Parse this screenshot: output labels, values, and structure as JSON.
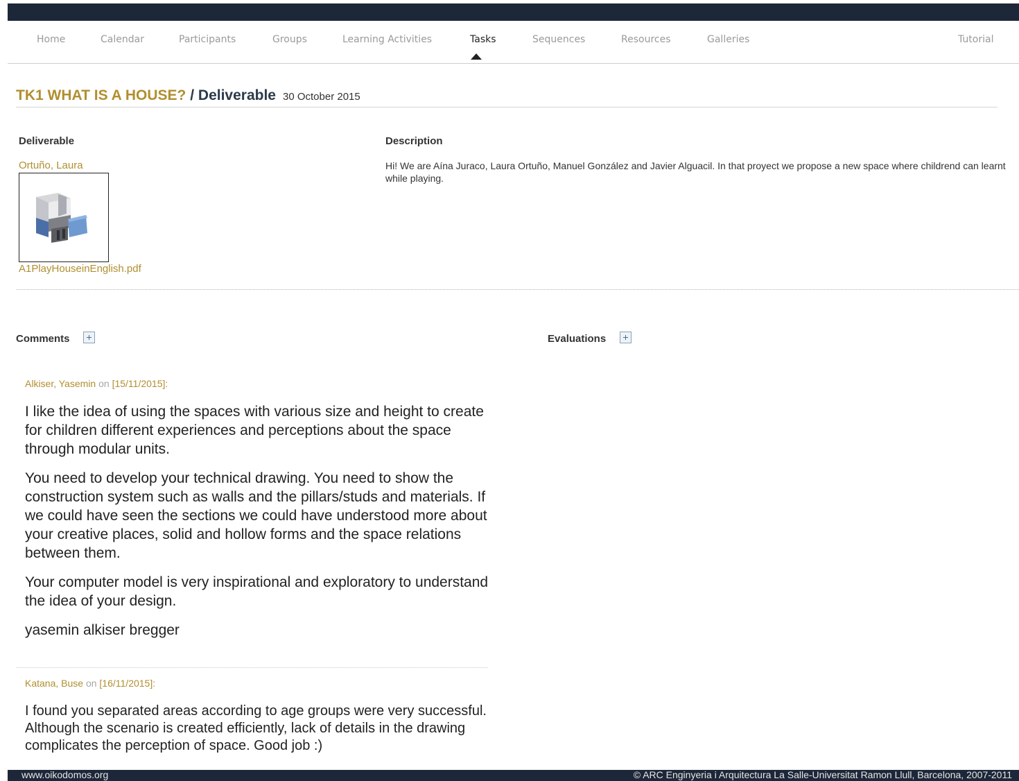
{
  "nav": {
    "items": [
      {
        "label": "Home"
      },
      {
        "label": "Calendar"
      },
      {
        "label": "Participants"
      },
      {
        "label": "Groups"
      },
      {
        "label": "Learning Activities"
      },
      {
        "label": "Tasks",
        "active": true
      },
      {
        "label": "Sequences"
      },
      {
        "label": "Resources"
      },
      {
        "label": "Galleries"
      }
    ],
    "tutorial": "Tutorial"
  },
  "title": {
    "task": "TK1 WHAT IS A HOUSE?",
    "separator": " / ",
    "page": "Deliverable",
    "date": "30 October 2015"
  },
  "deliverable": {
    "heading": "Deliverable",
    "author": "Ortuño, Laura",
    "thumbnail_icon": "house-model-icon",
    "file": "A1PlayHouseinEnglish.pdf"
  },
  "description": {
    "heading": "Description",
    "text": "Hi! We are Aína Juraco, Laura Ortuño, Manuel González and Javier Alguacil. In that proyect we propose a new space where childrend can learnt while playing."
  },
  "comments": {
    "heading": "Comments",
    "items": [
      {
        "author": "Alkiser, Yasemin",
        "on": "on",
        "date": "[15/11/2015]:",
        "paragraphs": [
          "I like the idea of using the spaces with various size and height to create for children different experiences and perceptions about the space through modular units.",
          "You need to develop your technical drawing. You need to show the construction system such as walls and the pillars/studs and materials. If we could have seen the sections we could have understood more about your creative places, solid and hollow forms and the space relations between them.",
          "Your computer model is very inspirational and exploratory to understand the idea of your design.",
          "yasemin alkiser bregger"
        ]
      },
      {
        "author": "Katana, Buse",
        "on": "on",
        "date": "[16/11/2015]:",
        "paragraphs": [
          "I found you separated areas according to age groups were very successful. Although the scenario is created efficiently, lack of details in the drawing complicates the perception of space. Good job :)"
        ]
      }
    ]
  },
  "evaluations": {
    "heading": "Evaluations"
  },
  "footer": {
    "left": "www.oikodomos.org",
    "right": "© ARC Enginyeria i Arquitectura La Salle-Universitat Ramon Llull, Barcelona, 2007-2011"
  },
  "colors": {
    "header_bar": "#1c2739",
    "link_gold": "#b18e2f",
    "nav_inactive": "#9a9a9a"
  }
}
